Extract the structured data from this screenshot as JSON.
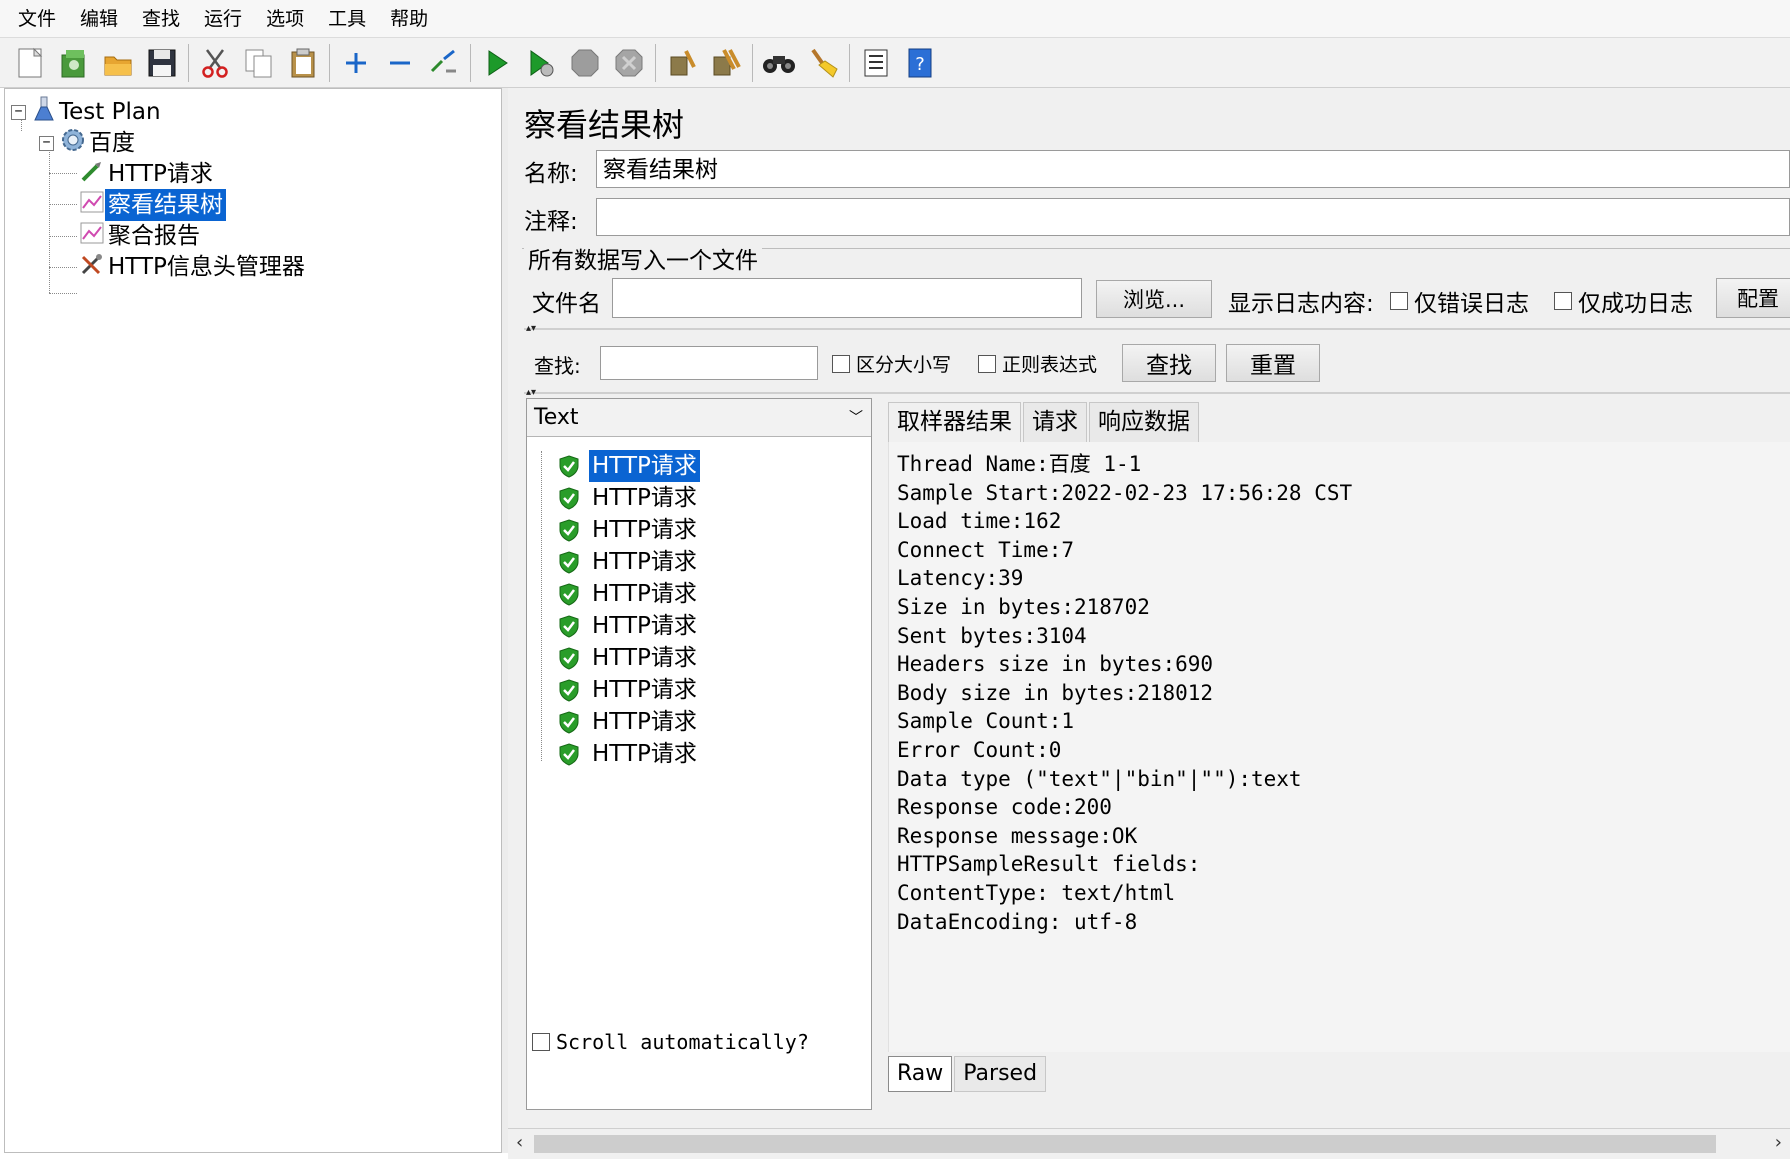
{
  "menu": [
    "文件",
    "编辑",
    "查找",
    "运行",
    "选项",
    "工具",
    "帮助"
  ],
  "toolbar": {
    "buttons": [
      {
        "icon": "new-icon"
      },
      {
        "icon": "templates-icon"
      },
      {
        "icon": "open-icon"
      },
      {
        "icon": "save-icon"
      },
      {
        "icon": "cut-icon"
      },
      {
        "icon": "copy-icon"
      },
      {
        "icon": "paste-icon"
      },
      {
        "icon": "expand-icon"
      },
      {
        "icon": "collapse-icon"
      },
      {
        "icon": "toggle-icon"
      },
      {
        "icon": "start-icon"
      },
      {
        "icon": "start-no-pause-icon"
      },
      {
        "icon": "stop-icon"
      },
      {
        "icon": "shutdown-icon"
      },
      {
        "icon": "clear-icon"
      },
      {
        "icon": "clear-all-icon"
      },
      {
        "icon": "search-icon"
      },
      {
        "icon": "reset-search-icon"
      },
      {
        "icon": "function-helper-icon"
      },
      {
        "icon": "help-icon"
      }
    ]
  },
  "tree": {
    "root": "Test Plan",
    "thread_group": "百度",
    "children": [
      "HTTP请求",
      "察看结果树",
      "聚合报告",
      "HTTP信息头管理器"
    ],
    "selected": "察看结果树"
  },
  "panel": {
    "title": "察看结果树",
    "name_label": "名称:",
    "name_value": "察看结果树",
    "comment_label": "注释:",
    "comment_value": "",
    "group_title": "所有数据写入一个文件",
    "filename_label": "文件名",
    "filename_value": "",
    "browse_button": "浏览...",
    "log_label": "显示日志内容:",
    "errors_only": "仅错误日志",
    "success_only": "仅成功日志",
    "configure_button": "配置"
  },
  "search": {
    "label": "查找:",
    "value": "",
    "case_sensitive": "区分大小写",
    "regex": "正则表达式",
    "find_button": "查找",
    "reset_button": "重置"
  },
  "results": {
    "renderer": "Text",
    "items": [
      "HTTP请求",
      "HTTP请求",
      "HTTP请求",
      "HTTP请求",
      "HTTP请求",
      "HTTP请求",
      "HTTP请求",
      "HTTP请求",
      "HTTP请求",
      "HTTP请求"
    ],
    "selected_index": 0,
    "scroll_auto_label": "Scroll automatically?"
  },
  "detail": {
    "tabs": [
      "取样器结果",
      "请求",
      "响应数据"
    ],
    "active_tab": 0,
    "lines": [
      "Thread Name:百度 1-1",
      "Sample Start:2022-02-23 17:56:28 CST",
      "Load time:162",
      "Connect Time:7",
      "Latency:39",
      "Size in bytes:218702",
      "Sent bytes:3104",
      "Headers size in bytes:690",
      "Body size in bytes:218012",
      "Sample Count:1",
      "Error Count:0",
      "Data type (\"text\"|\"bin\"|\"\"):text",
      "Response code:200",
      "Response message:OK",
      "",
      "",
      "HTTPSampleResult fields:",
      "ContentType: text/html",
      "DataEncoding: utf-8"
    ],
    "subtabs": [
      "Raw",
      "Parsed"
    ],
    "active_subtab": 0
  },
  "colors": {
    "selection": "#0a64d2",
    "panel_bg": "#f0f0f0",
    "success_green": "#2a9d2a"
  }
}
